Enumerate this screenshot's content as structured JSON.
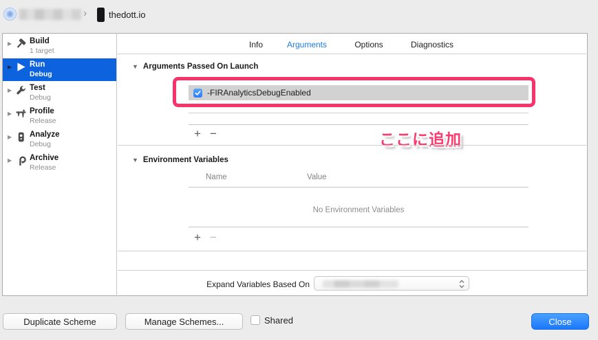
{
  "colors": {
    "accent_blue": "#1a7ce5",
    "selection_blue": "#0c63dd",
    "close_button_blue": "#2e85fb",
    "highlight_pink": "#f8326b",
    "selected_row_gray": "#d2d2d2"
  },
  "toolbar": {
    "chevron": "›",
    "destination": "thedott.io"
  },
  "sidebar": {
    "disclosure": "▶",
    "items": [
      {
        "label": "Build",
        "sublabel": "1 target",
        "icon": "hammer-icon",
        "selected": false
      },
      {
        "label": "Run",
        "sublabel": "Debug",
        "icon": "play-icon",
        "selected": true
      },
      {
        "label": "Test",
        "sublabel": "Debug",
        "icon": "wrench-icon",
        "selected": false
      },
      {
        "label": "Profile",
        "sublabel": "Release",
        "icon": "caliper-icon",
        "selected": false
      },
      {
        "label": "Analyze",
        "sublabel": "Debug",
        "icon": "analyze-icon",
        "selected": false
      },
      {
        "label": "Archive",
        "sublabel": "Release",
        "icon": "archive-icon",
        "selected": false
      }
    ]
  },
  "tabs": {
    "items": [
      {
        "label": "Info",
        "selected": false
      },
      {
        "label": "Arguments",
        "selected": true
      },
      {
        "label": "Options",
        "selected": false
      },
      {
        "label": "Diagnostics",
        "selected": false
      }
    ]
  },
  "arguments_section": {
    "disclosure": "▼",
    "title": "Arguments Passed On Launch",
    "rows": [
      {
        "checked": true,
        "value": "-FIRAnalyticsDebugEnabled"
      }
    ],
    "add": "+",
    "remove": "−"
  },
  "annotation": {
    "text": "ここに追加"
  },
  "environment_section": {
    "disclosure": "▼",
    "title": "Environment Variables",
    "columns": {
      "name": "Name",
      "value": "Value"
    },
    "empty": "No Environment Variables",
    "add": "+",
    "remove": "−"
  },
  "footer": {
    "label": "Expand Variables Based On"
  },
  "bottom_bar": {
    "duplicate": "Duplicate Scheme",
    "manage": "Manage Schemes...",
    "shared": "Shared",
    "shared_checked": false,
    "close": "Close"
  }
}
